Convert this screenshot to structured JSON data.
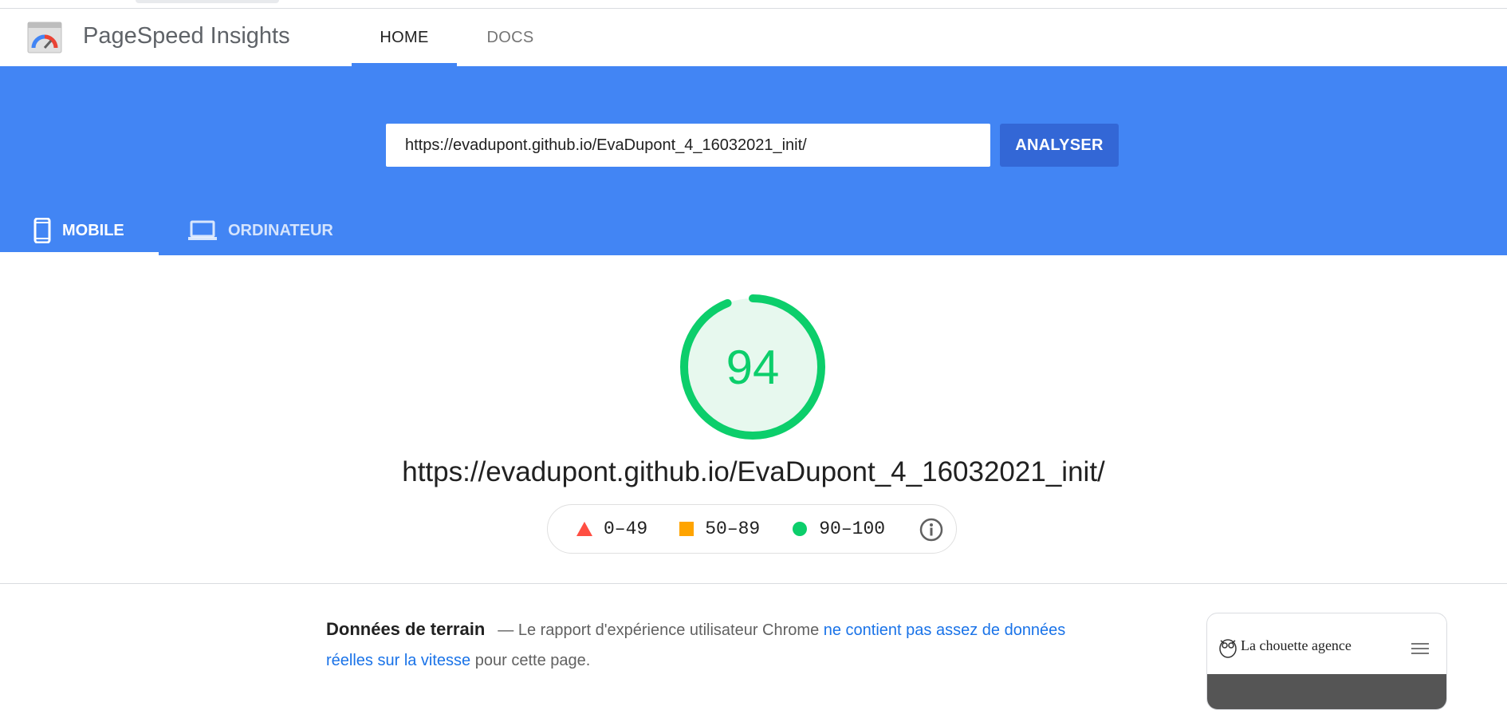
{
  "header": {
    "brand": "PageSpeed Insights",
    "nav": {
      "home": "HOME",
      "docs": "DOCS"
    }
  },
  "search": {
    "url_value": "https://evadupont.github.io/EvaDupont_4_16032021_init/",
    "analyse_label": "ANALYSER"
  },
  "device_tabs": {
    "mobile": "MOBILE",
    "desktop": "ORDINATEUR",
    "selected": "MOBILE"
  },
  "score": {
    "value": "94",
    "color": "#0cce6b"
  },
  "result_url": "https://evadupont.github.io/EvaDupont_4_16032021_init/",
  "legend": {
    "fail": "0–49",
    "average": "50–89",
    "pass": "90–100",
    "colors": {
      "fail": "#ff4e42",
      "average": "#ffa400",
      "pass": "#0cce6b"
    }
  },
  "field_data": {
    "title": "Données de terrain",
    "text_before": "— Le rapport d'expérience utilisateur Chrome ",
    "link_text": "ne contient pas assez de données réelles sur la vitesse",
    "text_after": " pour cette page."
  },
  "thumbnail": {
    "title": "La chouette agence"
  },
  "colors": {
    "brand_blue": "#4285f4",
    "button_blue": "#3367d6"
  }
}
